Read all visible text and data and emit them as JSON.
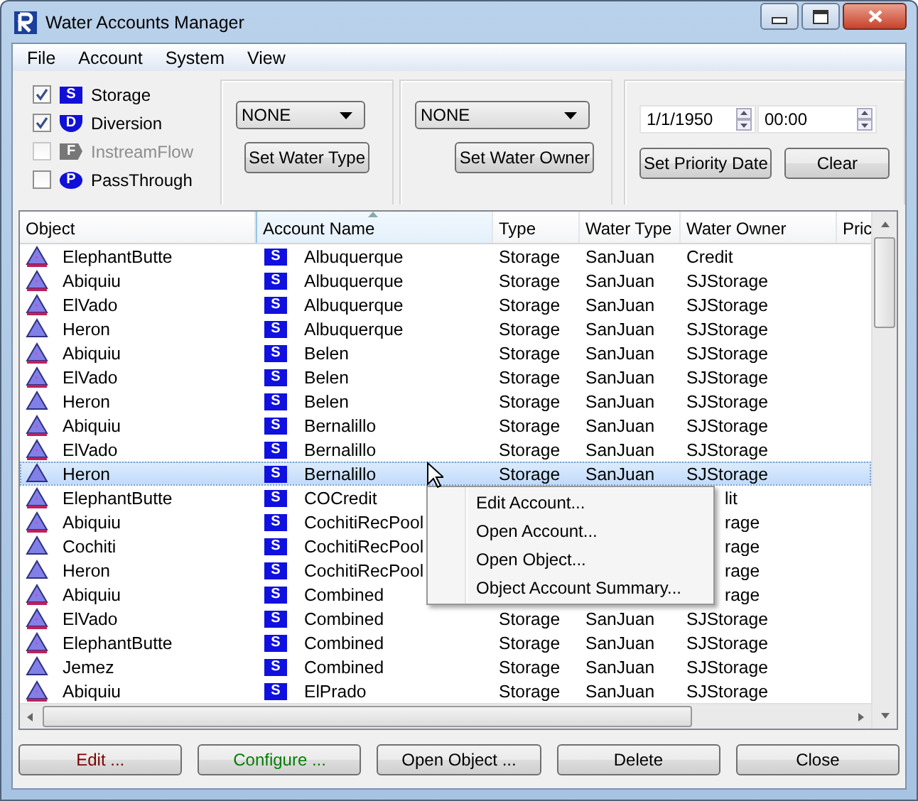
{
  "window": {
    "title": "Water Accounts Manager"
  },
  "menu_bar": [
    "File",
    "Account",
    "System",
    "View"
  ],
  "filters": [
    {
      "label": "Storage",
      "badge": "S",
      "kind": "rect",
      "checked": true,
      "disabled": false
    },
    {
      "label": "Diversion",
      "badge": "D",
      "kind": "shield",
      "checked": true,
      "disabled": false
    },
    {
      "label": "InstreamFlow",
      "badge": "F",
      "kind": "tag",
      "checked": false,
      "disabled": true
    },
    {
      "label": "PassThrough",
      "badge": "P",
      "kind": "oval",
      "checked": false,
      "disabled": false
    }
  ],
  "water_type": {
    "value": "NONE",
    "button": "Set Water Type"
  },
  "water_owner": {
    "value": "NONE",
    "button": "Set Water Owner"
  },
  "priority": {
    "date": "1/1/1950",
    "time": "00:00",
    "set_button": "Set Priority Date",
    "clear_button": "Clear"
  },
  "table": {
    "columns": [
      {
        "label": "Object",
        "sorted": false
      },
      {
        "label": "Account Name",
        "sorted": true
      },
      {
        "label": "Type",
        "sorted": false
      },
      {
        "label": "Water Type",
        "sorted": false
      },
      {
        "label": "Water Owner",
        "sorted": false
      },
      {
        "label": "Pric",
        "sorted": false
      }
    ],
    "rows": [
      {
        "object": "ElephantButte",
        "kind": "marked",
        "badge": "S",
        "account": "Albuquerque",
        "type": "Storage",
        "water_type": "SanJuan",
        "owner": "Credit",
        "selected": false
      },
      {
        "object": "Abiquiu",
        "kind": "marked",
        "badge": "S",
        "account": "Albuquerque",
        "type": "Storage",
        "water_type": "SanJuan",
        "owner": "SJStorage",
        "selected": false
      },
      {
        "object": "ElVado",
        "kind": "marked",
        "badge": "S",
        "account": "Albuquerque",
        "type": "Storage",
        "water_type": "SanJuan",
        "owner": "SJStorage",
        "selected": false
      },
      {
        "object": "Heron",
        "kind": "plain",
        "badge": "S",
        "account": "Albuquerque",
        "type": "Storage",
        "water_type": "SanJuan",
        "owner": "SJStorage",
        "selected": false
      },
      {
        "object": "Abiquiu",
        "kind": "marked",
        "badge": "S",
        "account": "Belen",
        "type": "Storage",
        "water_type": "SanJuan",
        "owner": "SJStorage",
        "selected": false
      },
      {
        "object": "ElVado",
        "kind": "marked",
        "badge": "S",
        "account": "Belen",
        "type": "Storage",
        "water_type": "SanJuan",
        "owner": "SJStorage",
        "selected": false
      },
      {
        "object": "Heron",
        "kind": "plain",
        "badge": "S",
        "account": "Belen",
        "type": "Storage",
        "water_type": "SanJuan",
        "owner": "SJStorage",
        "selected": false
      },
      {
        "object": "Abiquiu",
        "kind": "marked",
        "badge": "S",
        "account": "Bernalillo",
        "type": "Storage",
        "water_type": "SanJuan",
        "owner": "SJStorage",
        "selected": false
      },
      {
        "object": "ElVado",
        "kind": "marked",
        "badge": "S",
        "account": "Bernalillo",
        "type": "Storage",
        "water_type": "SanJuan",
        "owner": "SJStorage",
        "selected": false
      },
      {
        "object": "Heron",
        "kind": "plain",
        "badge": "S",
        "account": "Bernalillo",
        "type": "Storage",
        "water_type": "SanJuan",
        "owner": "SJStorage",
        "selected": true
      },
      {
        "object": "ElephantButte",
        "kind": "marked",
        "badge": "S",
        "account": "COCredit",
        "owner": "lit",
        "selected": false
      },
      {
        "object": "Abiquiu",
        "kind": "marked",
        "badge": "S",
        "account": "CochitiRecPool",
        "owner": "rage",
        "selected": false
      },
      {
        "object": "Cochiti",
        "kind": "plain",
        "badge": "S",
        "account": "CochitiRecPool",
        "owner": "rage",
        "selected": false
      },
      {
        "object": "Heron",
        "kind": "plain",
        "badge": "S",
        "account": "CochitiRecPool",
        "owner": "rage",
        "selected": false
      },
      {
        "object": "Abiquiu",
        "kind": "marked",
        "badge": "S",
        "account": "Combined",
        "owner": "rage",
        "selected": false
      },
      {
        "object": "ElVado",
        "kind": "marked",
        "badge": "S",
        "account": "Combined",
        "type": "Storage",
        "water_type": "SanJuan",
        "owner": "SJStorage",
        "selected": false
      },
      {
        "object": "ElephantButte",
        "kind": "marked",
        "badge": "S",
        "account": "Combined",
        "type": "Storage",
        "water_type": "SanJuan",
        "owner": "SJStorage",
        "selected": false
      },
      {
        "object": "Jemez",
        "kind": "plain",
        "badge": "S",
        "account": "Combined",
        "type": "Storage",
        "water_type": "SanJuan",
        "owner": "SJStorage",
        "selected": false
      },
      {
        "object": "Abiquiu",
        "kind": "marked",
        "badge": "S",
        "account": "ElPrado",
        "type": "Storage",
        "water_type": "SanJuan",
        "owner": "SJStorage",
        "selected": false
      }
    ]
  },
  "context_menu": [
    "Edit Account...",
    "Open Account...",
    "Open Object...",
    "Object Account Summary..."
  ],
  "buttons": [
    {
      "label": "Edit ...",
      "color": "#800000"
    },
    {
      "label": "Configure ...",
      "color": "#008000"
    },
    {
      "label": "Open Object ...",
      "color": "#000000"
    },
    {
      "label": "Delete",
      "color": "#000000"
    },
    {
      "label": "Close",
      "color": "#000000"
    }
  ]
}
